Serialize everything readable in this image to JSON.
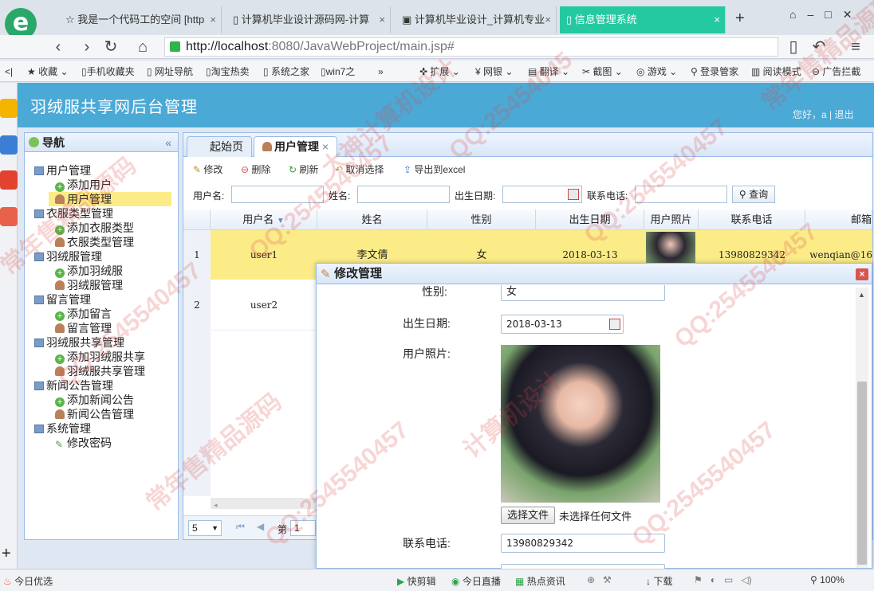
{
  "browser": {
    "tabs": [
      {
        "label": "我是一个代码工的空间 [http"
      },
      {
        "label": "计算机毕业设计源码网-计算"
      },
      {
        "label": "计算机毕业设计_计算机专业"
      },
      {
        "label": "信息管理系统"
      }
    ],
    "tab_close": "×",
    "new_tab": "+",
    "url_host": "http://localhost",
    "url_rest": ":8080/JavaWebProject/main.jsp#",
    "bookmarks": [
      "收藏",
      "手机收藏夹",
      "网址导航",
      "淘宝热卖",
      "系统之家",
      "win7之"
    ],
    "bookmarks_more": "»",
    "right_tools": [
      "扩展",
      "网银",
      "翻译",
      "截图",
      "游戏",
      "登录管家",
      "阅读模式",
      "广告拦截"
    ]
  },
  "app": {
    "title": "羽绒服共享网后台管理",
    "greeting": "您好，a | 退出"
  },
  "nav": {
    "title": "导航",
    "collapse": "«",
    "tree": [
      {
        "label": "用户管理",
        "type": "folder"
      },
      {
        "label": "添加用户",
        "type": "add"
      },
      {
        "label": "用户管理",
        "type": "user",
        "selected": true
      },
      {
        "label": "衣服类型管理",
        "type": "folder"
      },
      {
        "label": "添加衣服类型",
        "type": "add"
      },
      {
        "label": "衣服类型管理",
        "type": "user"
      },
      {
        "label": "羽绒服管理",
        "type": "folder"
      },
      {
        "label": "添加羽绒服",
        "type": "add"
      },
      {
        "label": "羽绒服管理",
        "type": "user"
      },
      {
        "label": "留言管理",
        "type": "folder"
      },
      {
        "label": "添加留言",
        "type": "add"
      },
      {
        "label": "留言管理",
        "type": "user"
      },
      {
        "label": "羽绒服共享管理",
        "type": "folder"
      },
      {
        "label": "添加羽绒服共享",
        "type": "add"
      },
      {
        "label": "羽绒服共享管理",
        "type": "user"
      },
      {
        "label": "新闻公告管理",
        "type": "folder"
      },
      {
        "label": "添加新闻公告",
        "type": "add"
      },
      {
        "label": "新闻公告管理",
        "type": "user"
      },
      {
        "label": "系统管理",
        "type": "folder"
      },
      {
        "label": "修改密码",
        "type": "pen"
      }
    ]
  },
  "main": {
    "tabs": [
      {
        "label": "起始页"
      },
      {
        "label": "用户管理",
        "closable": "×"
      }
    ],
    "toolbar": [
      "修改",
      "删除",
      "刷新",
      "取消选择",
      "导出到excel"
    ],
    "search": {
      "user": "用户名:",
      "name": "姓名:",
      "birth": "出生日期:",
      "phone": "联系电话:",
      "button": "查询"
    },
    "columns": [
      "用户名",
      "姓名",
      "性别",
      "出生日期",
      "用户照片",
      "联系电话",
      "邮箱"
    ],
    "sort_mark": "▼",
    "rows": [
      {
        "no": "1",
        "user": "user1",
        "name": "李文倩",
        "sex": "女",
        "birth": "2018-03-13",
        "phone": "13980829342",
        "email": "wenqian@16"
      },
      {
        "no": "2",
        "user": "user2",
        "name": "",
        "sex": "",
        "birth": "",
        "phone": "",
        "email": ""
      }
    ],
    "pager": {
      "size": "5",
      "page_label": "第",
      "page": "1"
    }
  },
  "dialog": {
    "title": "修改管理",
    "close": "×",
    "sex_label": "性别:",
    "sex_value": "女",
    "birth_label": "出生日期:",
    "birth_value": "2018-03-13",
    "photo_label": "用户照片:",
    "file_button": "选择文件",
    "file_status": "未选择任何文件",
    "phone_label": "联系电话:",
    "phone_value": "13980829342"
  },
  "status": [
    "今日优选",
    "快剪辑",
    "今日直播",
    "热点资讯",
    "下载",
    "100%"
  ],
  "watermarks": [
    "QQ:25454045",
    "常年售精品源码",
    "大神计算机设计",
    "QQ:2545540457",
    "计算机设计"
  ]
}
